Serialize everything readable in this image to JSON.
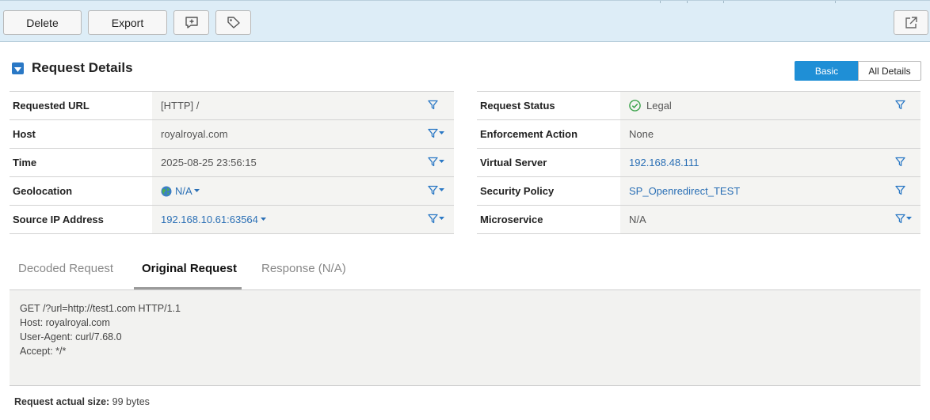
{
  "toolbar": {
    "delete_label": "Delete",
    "export_label": "Export",
    "comment_icon": "add-comment-icon",
    "tag_icon": "tag-icon",
    "popout_icon": "external-window-icon"
  },
  "section": {
    "title": "Request Details",
    "view_basic": "Basic",
    "view_all": "All Details"
  },
  "left_details": [
    {
      "label": "Requested URL",
      "value": "[HTTP] /"
    },
    {
      "label": "Host",
      "value": "royalroyal.com"
    },
    {
      "label": "Time",
      "value": "2025-08-25 23:56:15"
    },
    {
      "label": "Geolocation",
      "value": "N/A"
    },
    {
      "label": "Source IP Address",
      "value": "192.168.10.61:63564"
    }
  ],
  "right_details": [
    {
      "label": "Request Status",
      "value": "Legal"
    },
    {
      "label": "Enforcement Action",
      "value": "None"
    },
    {
      "label": "Virtual Server",
      "value": "192.168.48.111"
    },
    {
      "label": "Security Policy",
      "value": "SP_Openredirect_TEST"
    },
    {
      "label": "Microservice",
      "value": "N/A"
    }
  ],
  "tabs": [
    {
      "label": "Decoded Request"
    },
    {
      "label": "Original Request"
    },
    {
      "label": "Response (N/A)"
    }
  ],
  "request_lines": [
    "GET /?url=http://test1.com HTTP/1.1",
    "Host: royalroyal.com",
    "User-Agent: curl/7.68.0",
    "Accept: */*"
  ],
  "size": {
    "label": "Request actual size:",
    "value": "99 bytes"
  },
  "colors": {
    "toolbar_bg": "#ddedf7",
    "accent": "#1f8fd6",
    "link": "#2a6fb5",
    "status_ok": "#3aa24a",
    "row_bg": "#f4f4f2"
  }
}
